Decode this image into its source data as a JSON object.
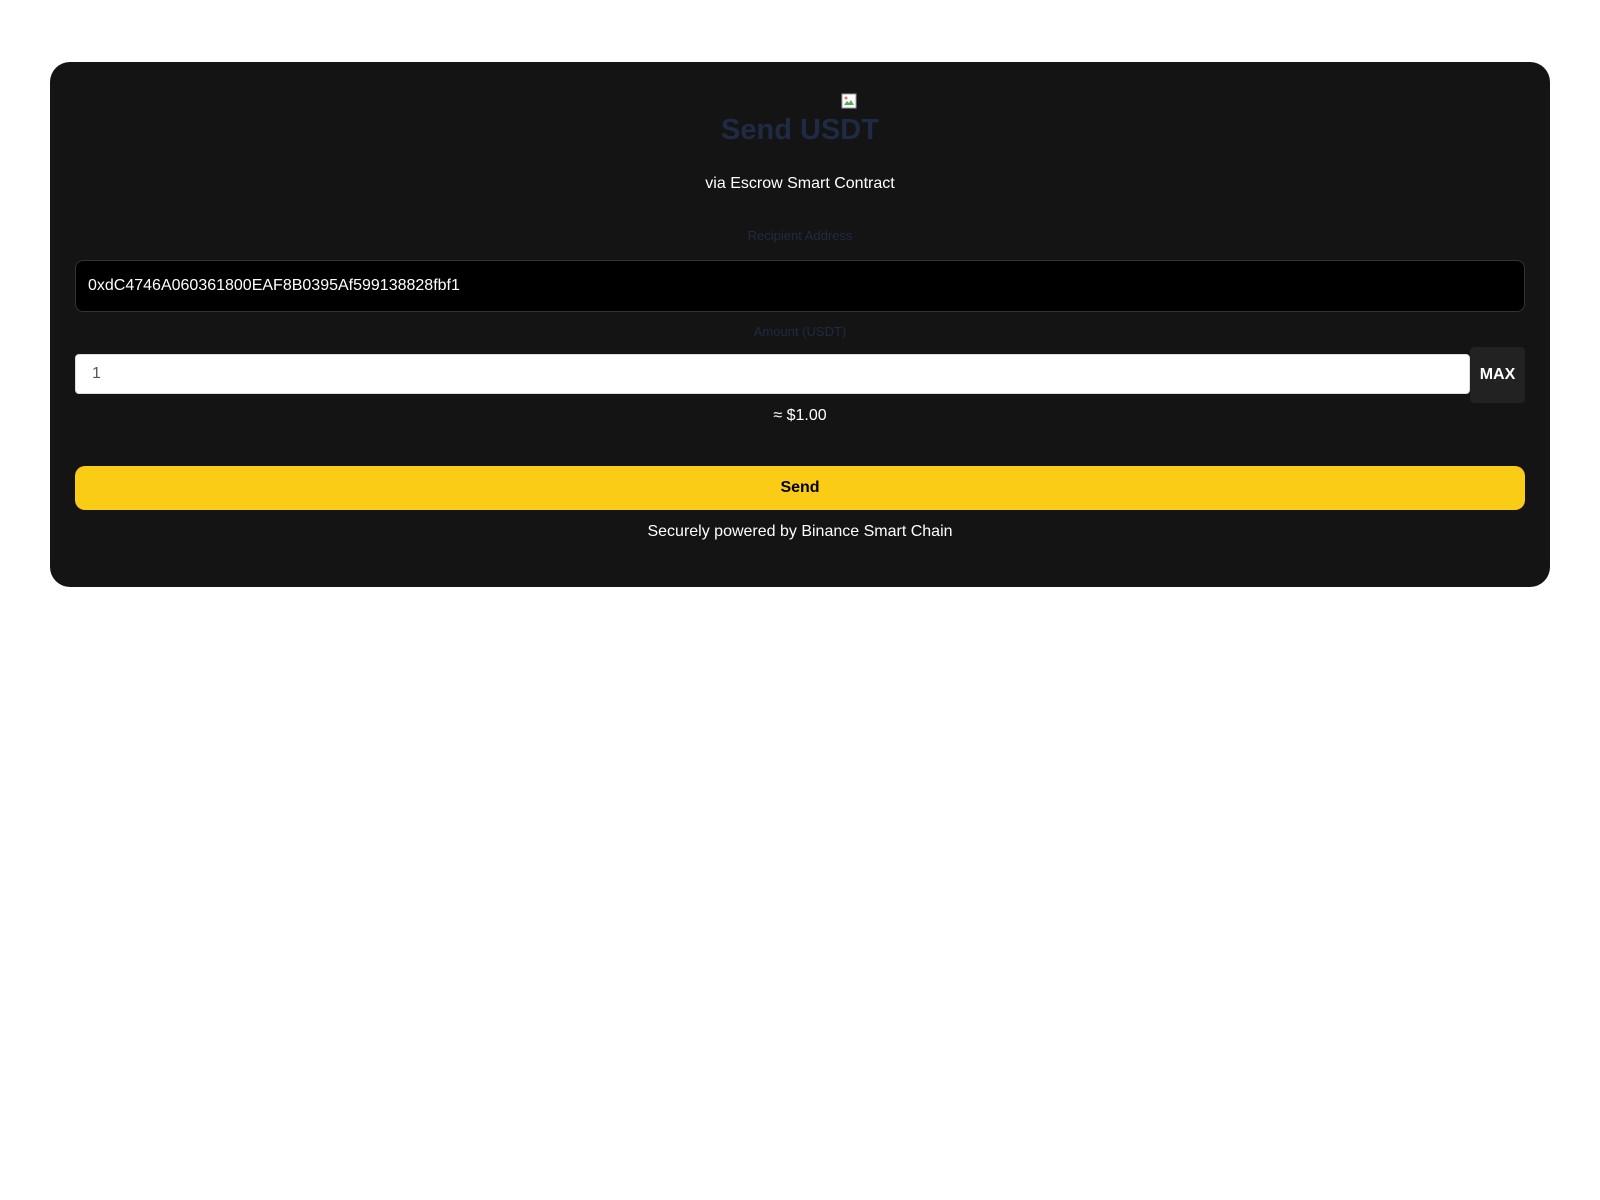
{
  "header": {
    "logo_icon": "broken-image-icon",
    "title": "Send USDT",
    "subtitle": "via Escrow Smart Contract"
  },
  "form": {
    "recipient_label": "Recipient Address",
    "recipient_value": "0xdC4746A060361800EAF8B0395Af599138828fbf1",
    "amount_label": "Amount (USDT)",
    "amount_value": "1",
    "max_label": "MAX",
    "usd_estimate": "≈ $1.00",
    "send_label": "Send"
  },
  "footer": {
    "text": "Securely powered by Binance Smart Chain"
  },
  "colors": {
    "card_background": "#141414",
    "accent": "#facc15",
    "label_color": "#1f2a44"
  }
}
